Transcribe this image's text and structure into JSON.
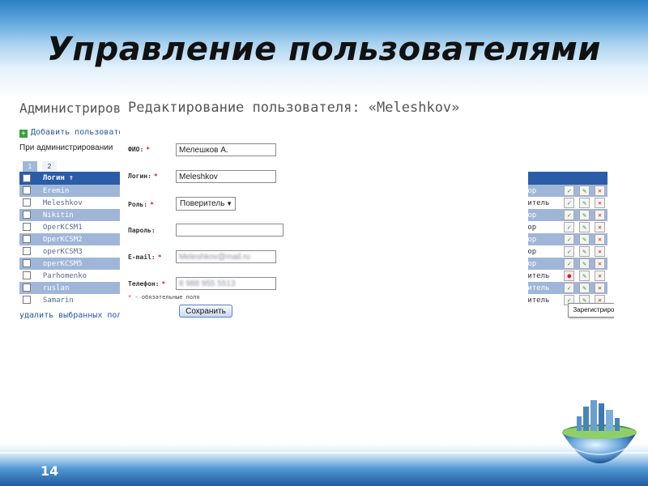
{
  "slide": {
    "title": "Управление пользователями",
    "number": "14"
  },
  "background": {
    "title": "Администрирование",
    "add_link": "Добавить пользователя",
    "admin_note": "При администрировании",
    "pages": [
      "1",
      "2"
    ],
    "table_header": "Логин ↑",
    "rows": [
      {
        "login": "Eremin",
        "role": "ор",
        "style": "even",
        "register_icon": false
      },
      {
        "login": "Meleshkov",
        "role": "итель",
        "style": "odd",
        "register_icon": false
      },
      {
        "login": "Nikitin",
        "role": "ор",
        "style": "even",
        "register_icon": false
      },
      {
        "login": "OperKCSM1",
        "role": "ор",
        "style": "odd",
        "register_icon": false
      },
      {
        "login": "OperKCSM2",
        "role": "ор",
        "style": "even",
        "register_icon": false
      },
      {
        "login": "operKCSM3",
        "role": "ор",
        "style": "odd",
        "register_icon": false
      },
      {
        "login": "operKCSM5",
        "role": "ор",
        "style": "even",
        "register_icon": false
      },
      {
        "login": "Parhomenko",
        "role": "итель",
        "style": "odd",
        "register_icon": true
      },
      {
        "login": "ruslan",
        "role": "итель",
        "style": "even",
        "register_icon": false
      },
      {
        "login": "Samarin",
        "role": "итель",
        "style": "odd",
        "register_icon": false
      }
    ],
    "delete_selected": "удалить выбранных поль"
  },
  "modal": {
    "title": "Редактирование пользователя: «Meleshkov»",
    "fio_label": "ФИО:",
    "fio_value": "Мелешков А.",
    "login_label": "Логин:",
    "login_value": "Meleshkov",
    "role_label": "Роль:",
    "role_value": "Поверитель",
    "password_label": "Пароль:",
    "password_value": "",
    "email_label": "E-mail:",
    "email_value": "Meleshkov@mail.ru",
    "phone_label": "Телефон:",
    "phone_value": "8 988 955 5513",
    "required_mark": "*",
    "required_note": " - обязательные поля",
    "save_button": "Сохранить"
  },
  "tooltip": "Зарегистрировать",
  "colors": {
    "header_row": "#2b5ca8",
    "even_row": "#9fb6d8",
    "required": "#d22222"
  }
}
